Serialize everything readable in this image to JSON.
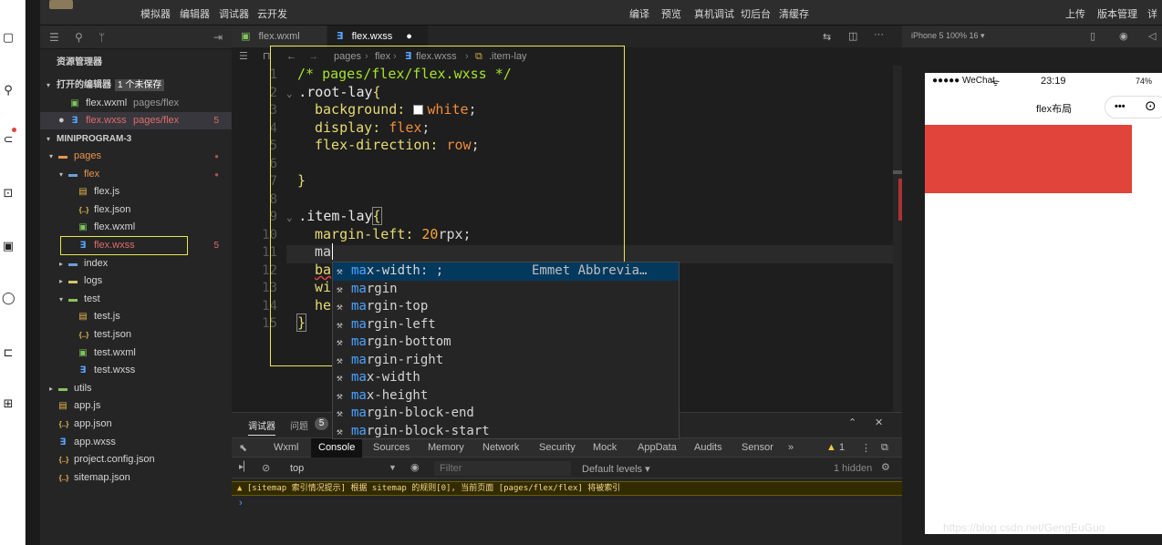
{
  "toolbar": {
    "left": [
      "模拟器",
      "编辑器",
      "调试器",
      "云开发"
    ],
    "center": [
      "编译",
      "预览",
      "真机调试",
      "切后台",
      "清缓存"
    ],
    "right": [
      "上传",
      "版本管理",
      "详"
    ]
  },
  "sidebar": {
    "title": "资源管理器",
    "open_editors": "打开的编辑器",
    "unsaved_badge": "1 个未保存",
    "open_files": [
      {
        "name": "flex.wxml",
        "path": "pages/flex",
        "type": "wxml"
      },
      {
        "name": "flex.wxss",
        "path": "pages/flex",
        "type": "wxss",
        "count": "5"
      }
    ],
    "project": "MINIPROGRAM-3",
    "tree": [
      {
        "label": "pages",
        "type": "pages",
        "indent": 1,
        "arrow": "▾"
      },
      {
        "label": "flex",
        "type": "folder",
        "indent": 2,
        "arrow": "▾"
      },
      {
        "label": "flex.js",
        "type": "js",
        "indent": 3
      },
      {
        "label": "flex.json",
        "type": "json",
        "indent": 3
      },
      {
        "label": "flex.wxml",
        "type": "wxml",
        "indent": 3
      },
      {
        "label": "flex.wxss",
        "type": "wxss",
        "indent": 3,
        "count": "5"
      },
      {
        "label": "index",
        "type": "folder",
        "indent": 2,
        "arrow": "▸"
      },
      {
        "label": "logs",
        "type": "logs",
        "indent": 2,
        "arrow": "▸"
      },
      {
        "label": "test",
        "type": "test",
        "indent": 2,
        "arrow": "▾"
      },
      {
        "label": "test.js",
        "type": "js",
        "indent": 3
      },
      {
        "label": "test.json",
        "type": "json",
        "indent": 3
      },
      {
        "label": "test.wxml",
        "type": "wxml",
        "indent": 3
      },
      {
        "label": "test.wxss",
        "type": "wxss",
        "indent": 3
      },
      {
        "label": "utils",
        "type": "utils",
        "indent": 1,
        "arrow": "▸"
      },
      {
        "label": "app.js",
        "type": "js",
        "indent": 1
      },
      {
        "label": "app.json",
        "type": "json",
        "indent": 1
      },
      {
        "label": "app.wxss",
        "type": "wxss",
        "indent": 1
      },
      {
        "label": "project.config.json",
        "type": "json",
        "indent": 1
      },
      {
        "label": "sitemap.json",
        "type": "json",
        "indent": 1
      }
    ]
  },
  "editor": {
    "tabs": [
      {
        "label": "flex.wxml",
        "active": false
      },
      {
        "label": "flex.wxss",
        "active": true,
        "dirty": "●"
      }
    ],
    "breadcrumb": [
      "pages",
      "flex",
      "flex.wxss",
      ".item-lay"
    ],
    "line_numbers": [
      "1",
      "2",
      "3",
      "4",
      "5",
      "6",
      "7",
      "8",
      "9",
      "10",
      "11",
      "12",
      "13",
      "14",
      "15"
    ],
    "code": {
      "l1": "/* pages/flex/flex.wxss */",
      "l2_sel": ".root-lay",
      "l2_brace": "{",
      "l3_prop": "background: ",
      "l3_val": "white",
      "l3_end": ";",
      "l4_prop": "display: ",
      "l4_val": "flex",
      "l4_end": ";",
      "l5_prop": "flex-direction: ",
      "l5_val": "row",
      "l5_end": ";",
      "l7_brace": "}",
      "l9_sel": ".item-lay",
      "l9_brace": "{",
      "l10_prop": "margin-left: ",
      "l10_num": "20",
      "l10_unit": "rpx;",
      "l11": "ma",
      "l12": "ba",
      "l13": "wi",
      "l14": "he",
      "l15": "}"
    },
    "suggestions": [
      {
        "match": "ma",
        "rest": "x-width: ;",
        "detail": "Emmet Abbrevia…"
      },
      {
        "match": "ma",
        "rest": "rgin"
      },
      {
        "match": "ma",
        "rest": "rgin-top"
      },
      {
        "match": "ma",
        "rest": "rgin-left"
      },
      {
        "match": "ma",
        "rest": "rgin-bottom"
      },
      {
        "match": "ma",
        "rest": "rgin-right"
      },
      {
        "match": "ma",
        "rest": "x-width"
      },
      {
        "match": "ma",
        "rest": "x-height"
      },
      {
        "match": "ma",
        "rest": "rgin-block-end"
      },
      {
        "match": "ma",
        "rest": "rgin-block-start"
      }
    ]
  },
  "debugger": {
    "tab_debug": "调试器",
    "tab_issues": "问题",
    "issues_count": "5",
    "tabs": [
      "Wxml",
      "Console",
      "Sources",
      "Memory",
      "Network",
      "Security",
      "Mock",
      "AppData",
      "Audits",
      "Sensor",
      "»"
    ],
    "active_tab": "Console",
    "warn_count": "1",
    "context": "top",
    "filter_placeholder": "Filter",
    "levels": "Default levels ▾",
    "hidden": "1 hidden",
    "warning": "[sitemap 索引情况提示] 根据 sitemap 的规则[0], 当前页面 [pages/flex/flex] 将被索引",
    "prompt": "›"
  },
  "simulator": {
    "device": "iPhone 5 100% 16 ▾",
    "carrier": "●●●●● WeChat",
    "time": "23:19",
    "battery": "74%",
    "page_title": "flex布局",
    "capsule": "•••",
    "block_color": "#e0443a"
  },
  "watermark": "https://blog.csdn.net/GengEuGuo"
}
